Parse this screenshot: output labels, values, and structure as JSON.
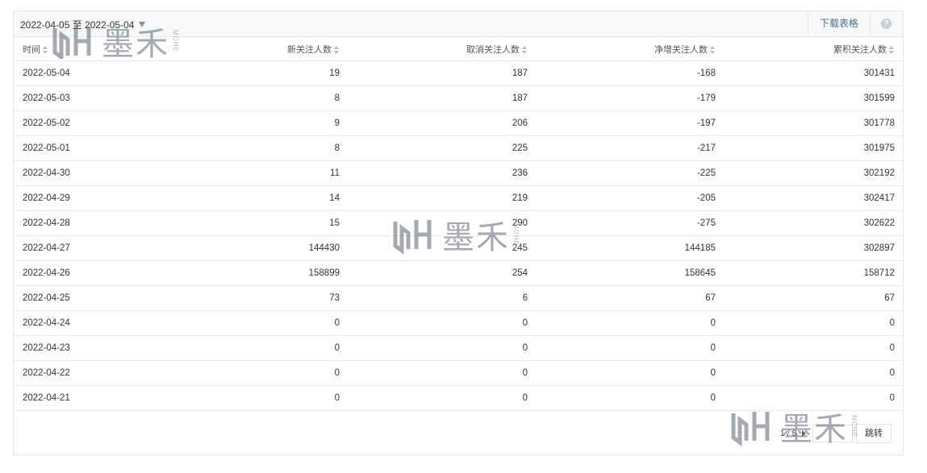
{
  "toolbar": {
    "date_range": "2022-04-05 至 2022-05-04",
    "download_label": "下载表格",
    "help_icon": "question-circle-icon",
    "help_symbol": "?"
  },
  "table": {
    "columns": [
      "时间",
      "新关注人数",
      "取消关注人数",
      "净增关注人数",
      "累积关注人数"
    ],
    "rows": [
      [
        "2022-05-04",
        "19",
        "187",
        "-168",
        "301431"
      ],
      [
        "2022-05-03",
        "8",
        "187",
        "-179",
        "301599"
      ],
      [
        "2022-05-02",
        "9",
        "206",
        "-197",
        "301778"
      ],
      [
        "2022-05-01",
        "8",
        "225",
        "-217",
        "301975"
      ],
      [
        "2022-04-30",
        "11",
        "236",
        "-225",
        "302192"
      ],
      [
        "2022-04-29",
        "14",
        "219",
        "-205",
        "302417"
      ],
      [
        "2022-04-28",
        "15",
        "290",
        "-275",
        "302622"
      ],
      [
        "2022-04-27",
        "144430",
        "245",
        "144185",
        "302897"
      ],
      [
        "2022-04-26",
        "158899",
        "254",
        "158645",
        "158712"
      ],
      [
        "2022-04-25",
        "73",
        "6",
        "67",
        "67"
      ],
      [
        "2022-04-24",
        "0",
        "0",
        "0",
        "0"
      ],
      [
        "2022-04-23",
        "0",
        "0",
        "0",
        "0"
      ],
      [
        "2022-04-22",
        "0",
        "0",
        "0",
        "0"
      ],
      [
        "2022-04-21",
        "0",
        "0",
        "0",
        "0"
      ]
    ]
  },
  "pager": {
    "info": "1 / 3",
    "jump_label": "跳转"
  },
  "watermark": {
    "text": "墨禾",
    "sub": "MOHE"
  },
  "colors": {
    "toolbar_bg": "#f6f8f9",
    "link": "#4d6b8a",
    "border": "#e4e8eb"
  }
}
